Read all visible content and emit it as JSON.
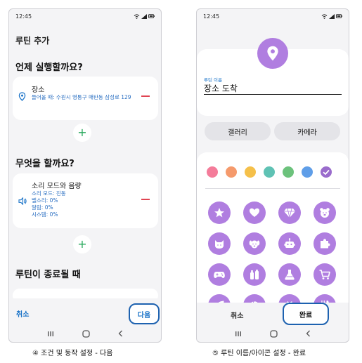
{
  "status": {
    "time": "12:45"
  },
  "screen_conditions": {
    "page_title": "루틴 추가",
    "when_heading": "언제 실행할까요?",
    "condition_card": {
      "title": "장소",
      "detail": "들어올 때: 수원시 영통구 매탄동 삼성로 129",
      "icon": "location-pin-icon"
    },
    "what_heading": "무엇을 할까요?",
    "action_card": {
      "title": "소리 모드와 음량",
      "detail_lines": [
        "소리 모드: 진동",
        "벨소리: 0%",
        "알림: 0%",
        "시스템: 0%"
      ],
      "icon": "speaker-icon"
    },
    "end_heading": "루틴이 종료될 때",
    "add_symbol": "+",
    "cancel_label": "취소",
    "next_label": "다음",
    "caption": "④ 조건 및 동작 설정 - 다음"
  },
  "screen_name_icon": {
    "name_label": "루틴 이름",
    "name_value": "장소 도착",
    "gallery_label": "갤러리",
    "camera_label": "카메라",
    "palette": [
      "#f47c9a",
      "#f59a6c",
      "#f5c04a",
      "#5fc2b4",
      "#6cc27c",
      "#5f9ee8",
      "#9a6ccc"
    ],
    "selected_color_index": 6,
    "icons": [
      "star-icon",
      "heart-icon",
      "diamond-icon",
      "bear-icon",
      "cat-icon",
      "dog-icon",
      "robot-icon",
      "puzzle-icon",
      "gamepad-icon",
      "bottles-icon",
      "flask-icon",
      "cart-icon",
      "leaf-icon",
      "baby-icon",
      "gift-icon",
      "utensils-icon"
    ],
    "accent_color": "#b07ee0",
    "cancel_label": "취소",
    "done_label": "완료",
    "caption": "⑤ 루틴 이름/아이콘 설정 - 완료"
  }
}
